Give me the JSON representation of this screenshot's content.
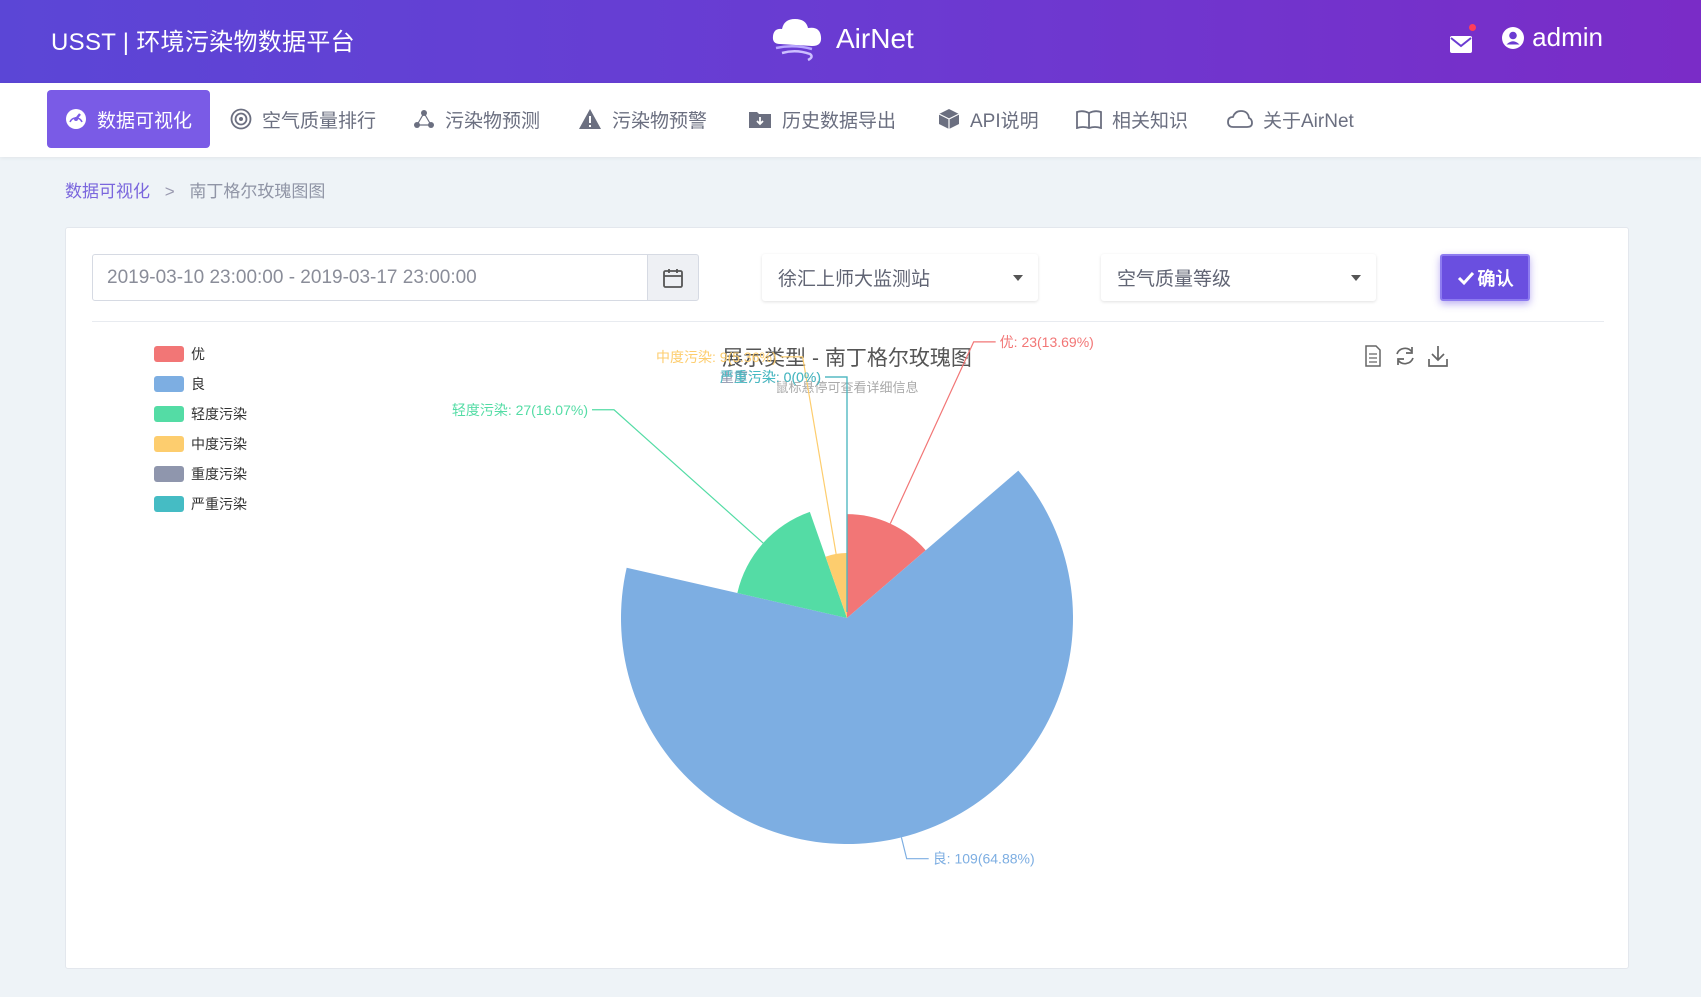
{
  "header": {
    "platform_title": "USST | 环境污染物数据平台",
    "logo_text": "AirNet",
    "username": "admin"
  },
  "nav": {
    "items": [
      {
        "label": "数据可视化",
        "icon": "dashboard-icon",
        "active": true
      },
      {
        "label": "空气质量排行",
        "icon": "target-icon",
        "active": false
      },
      {
        "label": "污染物预测",
        "icon": "network-icon",
        "active": false
      },
      {
        "label": "污染物预警",
        "icon": "warning-icon",
        "active": false
      },
      {
        "label": "历史数据导出",
        "icon": "folder-download-icon",
        "active": false
      },
      {
        "label": "API说明",
        "icon": "cube-icon",
        "active": false
      },
      {
        "label": "相关知识",
        "icon": "book-icon",
        "active": false
      },
      {
        "label": "关于AirNet",
        "icon": "cloud-icon",
        "active": false
      }
    ]
  },
  "breadcrumb": {
    "parent": "数据可视化",
    "separator": ">",
    "current": "南丁格尔玫瑰图图"
  },
  "filters": {
    "date_range": "2019-03-10 23:00:00 - 2019-03-17 23:00:00",
    "station": "徐汇上师大监测站",
    "metric": "空气质量等级",
    "confirm_label": "确认"
  },
  "chart_data": {
    "type": "pie",
    "variant": "nightingale-rose",
    "title": "展示类型 - 南丁格尔玫瑰图",
    "hover_hint": "鼠标悬停可查看详细信息",
    "legend_position": "top-left",
    "series": [
      {
        "name": "优",
        "value": 23,
        "percent": "13.69%",
        "color": "#f27676"
      },
      {
        "name": "良",
        "value": 109,
        "percent": "64.88%",
        "color": "#7daee2"
      },
      {
        "name": "轻度污染",
        "value": 27,
        "percent": "16.07%",
        "color": "#54dca5"
      },
      {
        "name": "中度污染",
        "value": 9,
        "percent": "5.36%",
        "color": "#fdcd6e"
      },
      {
        "name": "重度污染",
        "value": 0,
        "percent": "0%",
        "color": "#8f96ad"
      },
      {
        "name": "严重污染",
        "value": 0,
        "percent": "0%",
        "color": "#45bcc4"
      }
    ],
    "toolbox": [
      "data-view-icon",
      "restore-icon",
      "download-icon"
    ]
  },
  "colors": {
    "header_start": "#5b46d6",
    "header_end": "#7a2cc7",
    "accent": "#7a5be6",
    "button": "#6a4fe0"
  }
}
